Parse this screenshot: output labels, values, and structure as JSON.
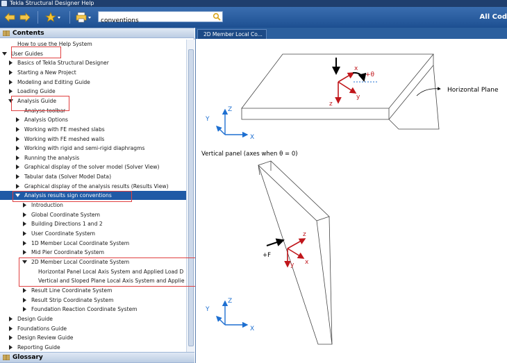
{
  "window": {
    "title": "Tekla Structural Designer Help"
  },
  "toolbar": {
    "search_value": "conventions",
    "all_content": "All Cod",
    "icons": [
      "back-arrow-icon",
      "forward-arrow-icon",
      "favorites-star-icon",
      "print-icon",
      "search-icon"
    ]
  },
  "contents": {
    "header": "Contents",
    "items": [
      {
        "label": "How to use the Help System",
        "level": 1,
        "toggle": "none"
      },
      {
        "label": "User Guides",
        "level": 0,
        "toggle": "open"
      },
      {
        "label": "Basics of Tekla Structural Designer",
        "level": 1,
        "toggle": "closed"
      },
      {
        "label": "Starting a New Project",
        "level": 1,
        "toggle": "closed"
      },
      {
        "label": "Modeling and Editing Guide",
        "level": 1,
        "toggle": "closed"
      },
      {
        "label": "Loading Guide",
        "level": 1,
        "toggle": "closed"
      },
      {
        "label": "Analysis Guide",
        "level": 1,
        "toggle": "open"
      },
      {
        "label": "Analyse toolbar",
        "level": 2,
        "toggle": "none"
      },
      {
        "label": "Analysis Options",
        "level": 2,
        "toggle": "closed"
      },
      {
        "label": "Working with FE meshed slabs",
        "level": 2,
        "toggle": "closed"
      },
      {
        "label": "Working with FE meshed walls",
        "level": 2,
        "toggle": "closed"
      },
      {
        "label": "Working with rigid and semi-rigid diaphragms",
        "level": 2,
        "toggle": "closed"
      },
      {
        "label": "Running the analysis",
        "level": 2,
        "toggle": "closed"
      },
      {
        "label": "Graphical display of the solver model (Solver View)",
        "level": 2,
        "toggle": "closed"
      },
      {
        "label": "Tabular data (Solver Model Data)",
        "level": 2,
        "toggle": "closed"
      },
      {
        "label": "Graphical display of the analysis results (Results View)",
        "level": 2,
        "toggle": "closed"
      },
      {
        "label": "Analysis results sign conventions",
        "level": 2,
        "toggle": "open",
        "selected": true
      },
      {
        "label": "Introduction",
        "level": 3,
        "toggle": "closed"
      },
      {
        "label": "Global Coordinate System",
        "level": 3,
        "toggle": "closed"
      },
      {
        "label": "Building Directions 1 and 2",
        "level": 3,
        "toggle": "closed"
      },
      {
        "label": "User Coordinate System",
        "level": 3,
        "toggle": "closed"
      },
      {
        "label": "1D Member Local Coordinate System",
        "level": 3,
        "toggle": "closed"
      },
      {
        "label": "Mid Pier Coordinate System",
        "level": 3,
        "toggle": "closed"
      },
      {
        "label": "2D Member Local Coordinate System",
        "level": 3,
        "toggle": "open"
      },
      {
        "label": "Horizontal Panel Local Axis System and Applied Load D",
        "level": 4,
        "toggle": "none"
      },
      {
        "label": "Vertical and Sloped Plane Local Axis System and Applie",
        "level": 4,
        "toggle": "none"
      },
      {
        "label": "Result Line Coordinate System",
        "level": 3,
        "toggle": "closed"
      },
      {
        "label": "Result Strip Coordinate System",
        "level": 3,
        "toggle": "closed"
      },
      {
        "label": "Foundation Reaction Coordinate System",
        "level": 3,
        "toggle": "closed"
      },
      {
        "label": "Design Guide",
        "level": 1,
        "toggle": "closed"
      },
      {
        "label": "Foundations Guide",
        "level": 1,
        "toggle": "closed"
      },
      {
        "label": "Design Review Guide",
        "level": 1,
        "toggle": "closed"
      },
      {
        "label": "Reporting Guide",
        "level": 1,
        "toggle": "closed"
      }
    ]
  },
  "glossary": {
    "header": "Glossary"
  },
  "topic": {
    "tab_label": "2D Member Local Co...",
    "diagram": {
      "horizontal_plane_label": "Horizontal Plane",
      "theta_label": "+θ",
      "vertical_caption": "Vertical panel (axes when θ = 0)",
      "force_label": "+F",
      "axis_x": "x",
      "axis_y": "y",
      "axis_z": "z",
      "global_X": "X",
      "global_Y": "Y",
      "global_Z": "Z"
    }
  },
  "colors": {
    "toolbar_blue": "#1d4f91",
    "selection_blue": "#1f5aa6",
    "local_axis_red": "#c0161b",
    "global_axis_blue": "#1d6fd1",
    "highlight_red": "#e04040"
  }
}
